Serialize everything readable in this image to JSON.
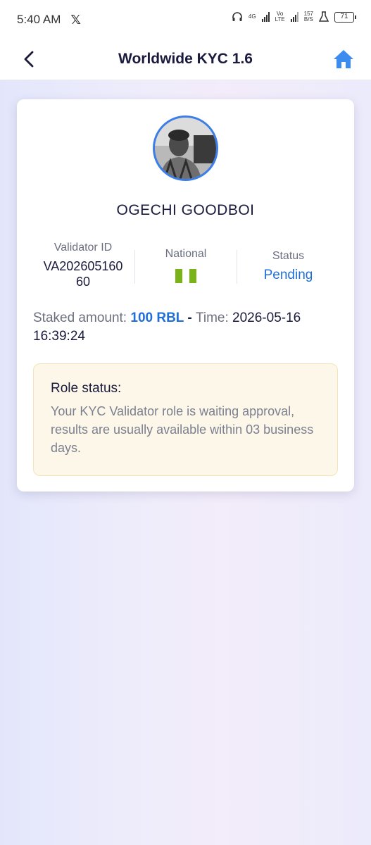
{
  "status_bar": {
    "time": "5:40 AM",
    "network_1": "4G",
    "network_2_top": "Vo",
    "network_2_bottom": "LTE",
    "speed_value": "157",
    "speed_unit": "B/S",
    "battery": "71"
  },
  "header": {
    "title": "Worldwide KYC 1.6"
  },
  "profile": {
    "name": "OGECHI GOODBOI",
    "validator_id_label": "Validator ID",
    "validator_id_line1": "VA202605160",
    "validator_id_line2": "60",
    "national_label": "National",
    "status_label": "Status",
    "status_value": "Pending"
  },
  "stake": {
    "label": "Staked amount: ",
    "amount": "100 RBL",
    "separator": " - ",
    "time_label": "Time: ",
    "time_value": "2026-05-16 16:39:24"
  },
  "role": {
    "title": "Role status:",
    "message": "Your KYC Validator role is waiting approval, results are usually available within 03 business days."
  },
  "colors": {
    "accent_blue": "#1f6fd6",
    "title_navy": "#1a1a3d",
    "flag_green": "#7ab317",
    "role_bg": "#fdf7e9"
  },
  "icons": {
    "back": "chevron-left-icon",
    "home": "home-icon",
    "national_flag": "nigeria-flag-icon"
  }
}
